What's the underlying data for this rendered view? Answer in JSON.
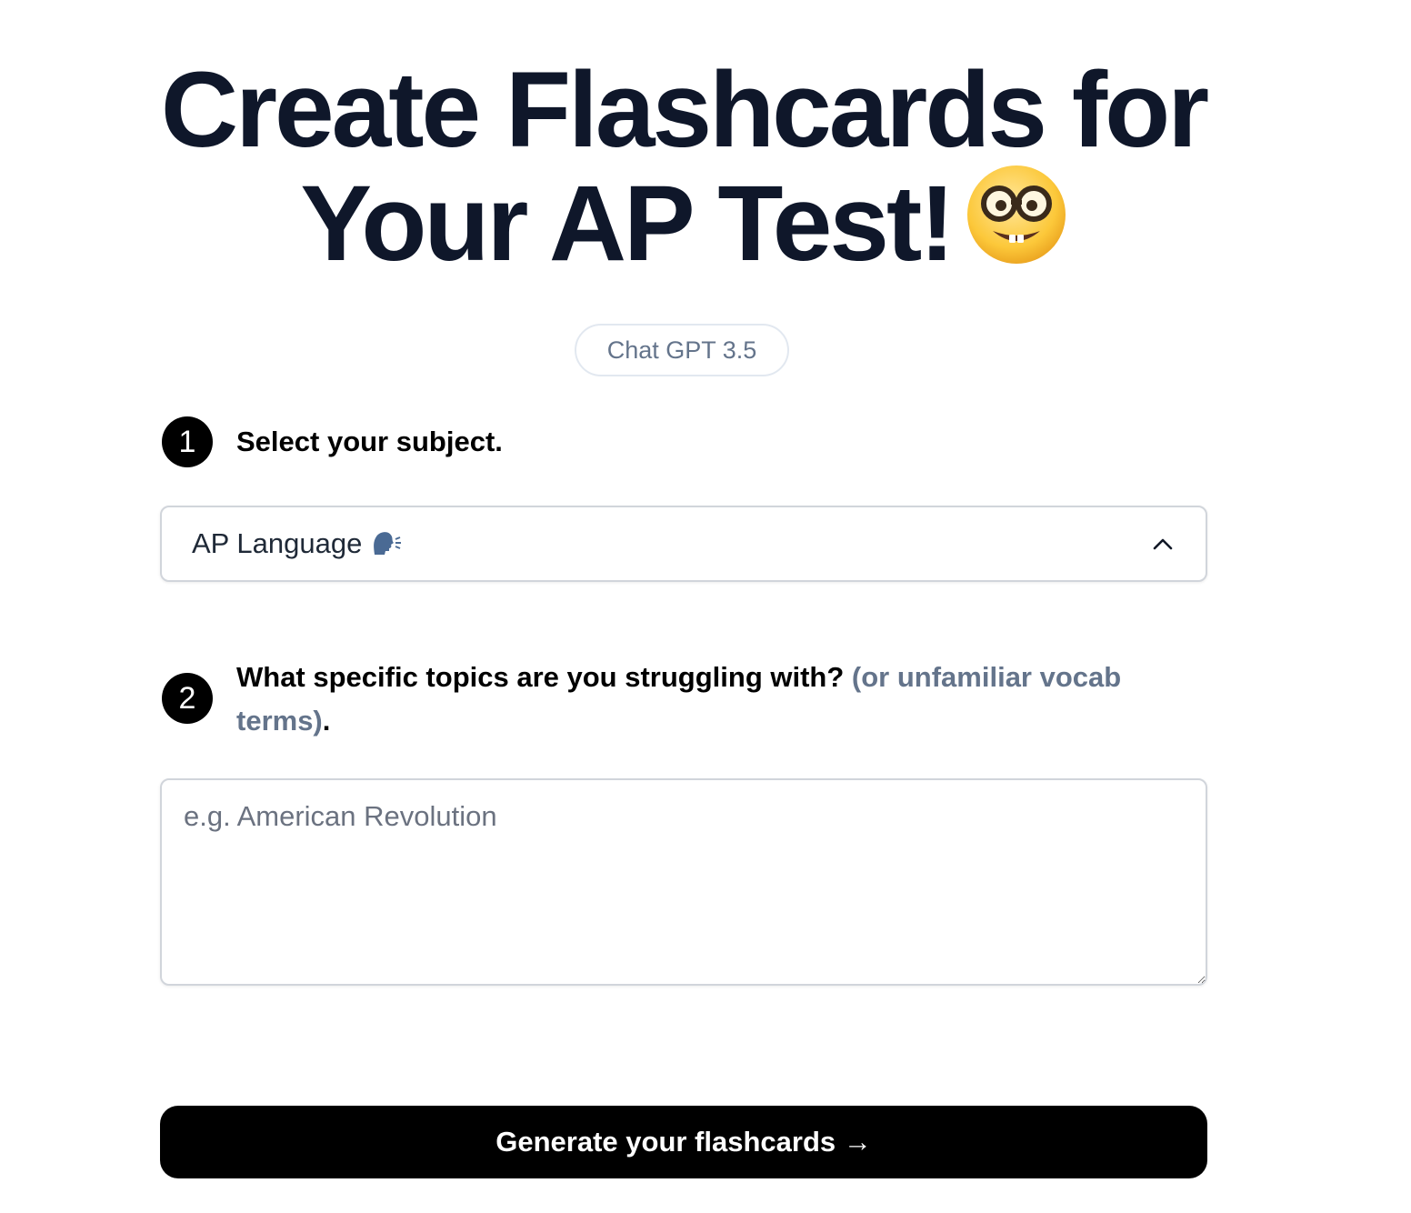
{
  "header": {
    "title_line1": "Create Flashcards for",
    "title_line2": "Your AP Test!",
    "title_emoji": "nerd-face-icon"
  },
  "model_badge": {
    "label": "Chat GPT 3.5"
  },
  "step1": {
    "number": "1",
    "label": "Select your subject."
  },
  "subject_select": {
    "selected_value": "AP Language",
    "icon": "speaking-head-icon",
    "expanded": true
  },
  "step2": {
    "number": "2",
    "label": "What specific topics are you struggling with?",
    "hint": "(or unfamiliar vocab terms)",
    "suffix": "."
  },
  "topics_input": {
    "value": "",
    "placeholder": "e.g. American Revolution"
  },
  "generate_button": {
    "label": "Generate your flashcards →"
  },
  "colors": {
    "heading": "#0f172a",
    "muted": "#64748b",
    "border": "#d1d5db",
    "button_bg": "#000000",
    "button_text": "#ffffff"
  }
}
